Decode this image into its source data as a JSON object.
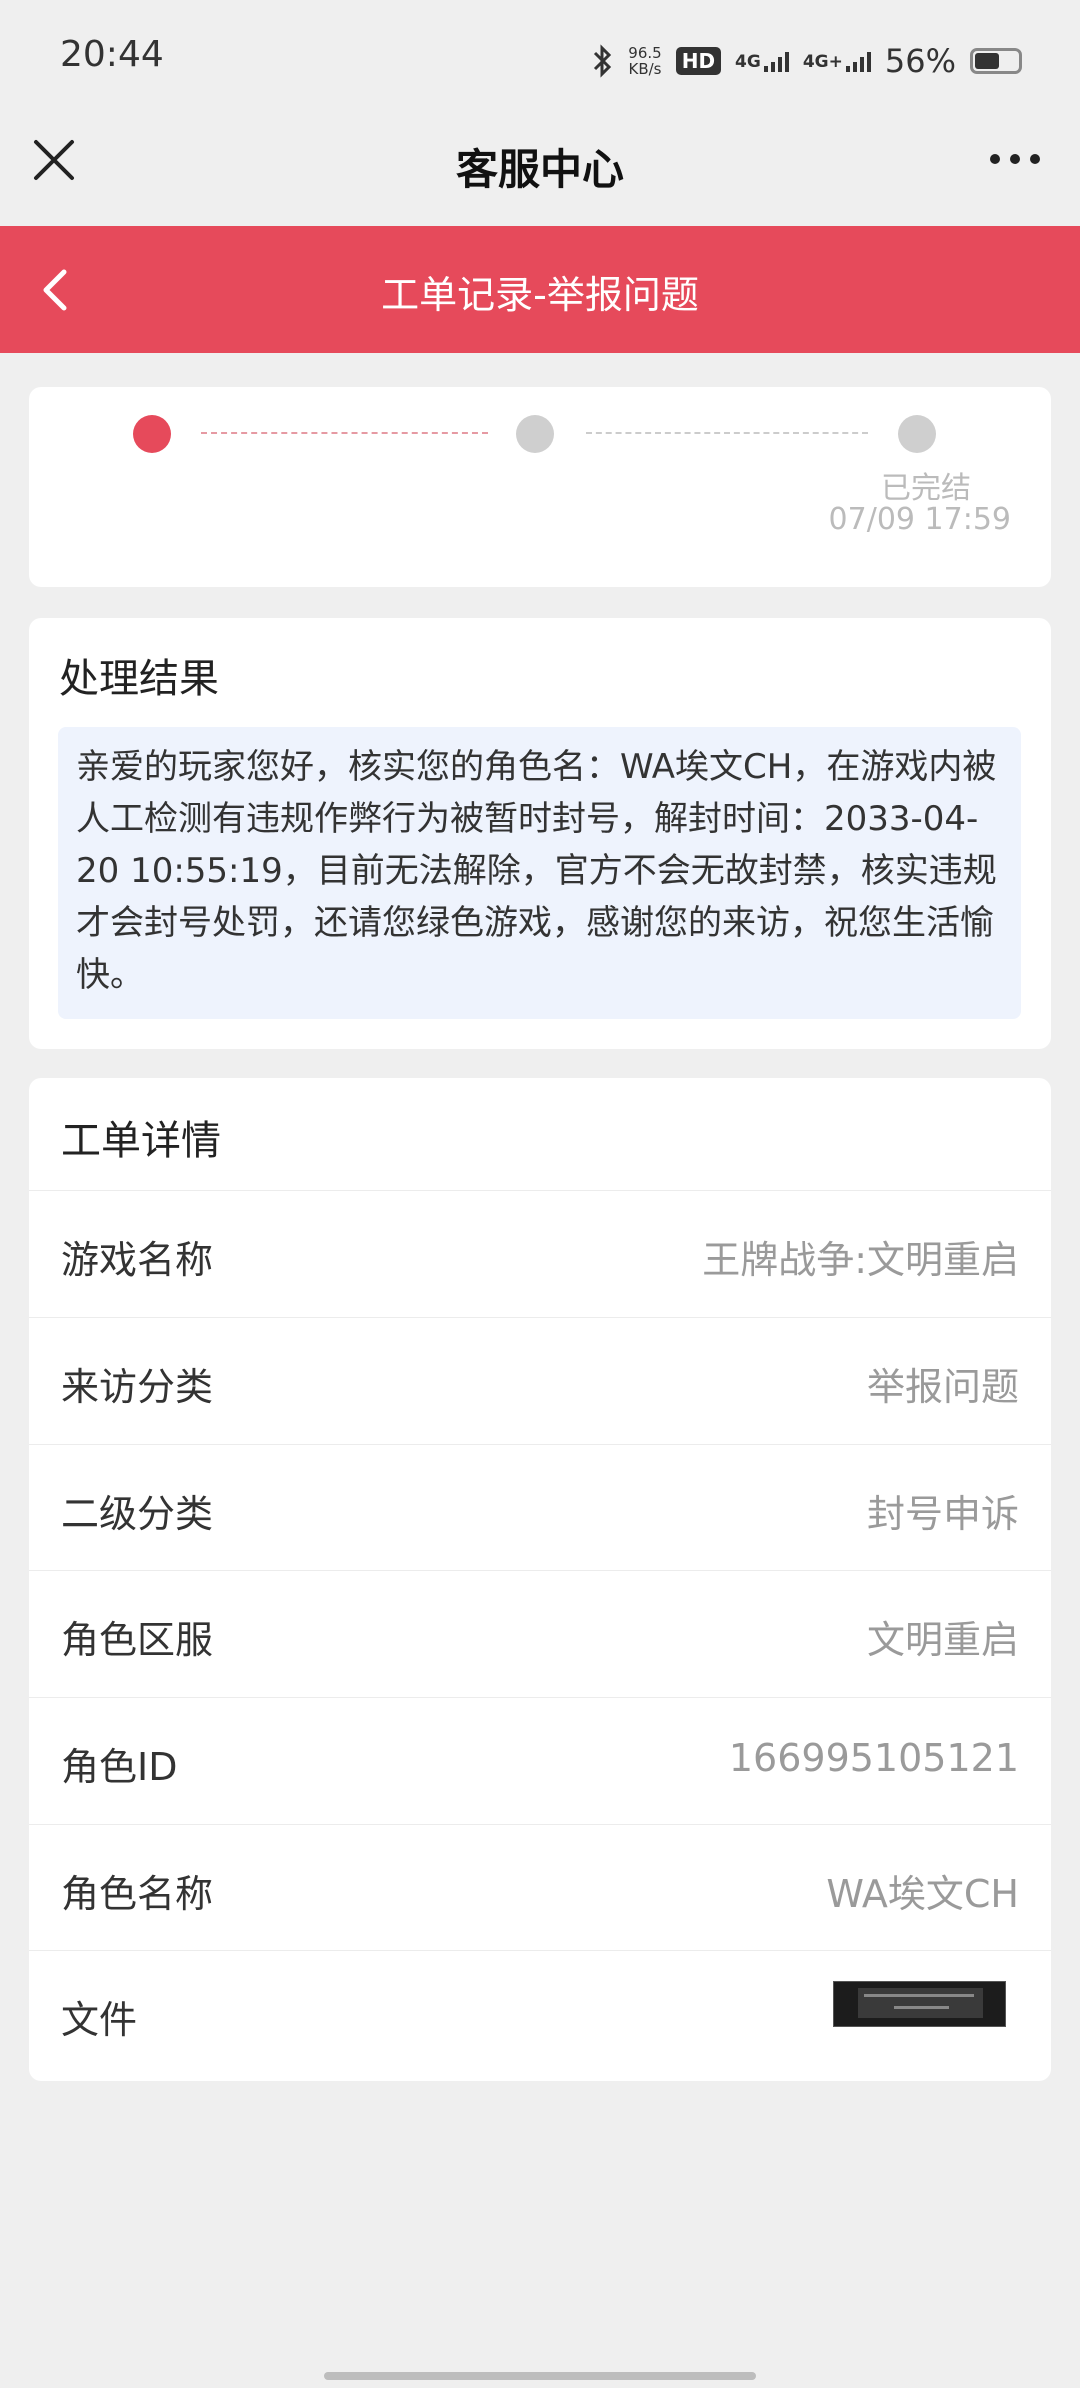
{
  "status_bar": {
    "time": "20:44",
    "speed_value": "96.5",
    "speed_unit": "KB/s",
    "hd_badge": "HD",
    "signal1_label": "4G",
    "signal2_label": "4G+",
    "battery_percent": "56%"
  },
  "nav": {
    "title": "客服中心"
  },
  "header": {
    "title": "工单记录-举报问题"
  },
  "progress": {
    "steps": [
      "",
      "",
      "已完结"
    ],
    "completed_time": "07/09 17:59",
    "colors": {
      "active": "#e64a5b",
      "inactive": "#cfcfcf"
    }
  },
  "result": {
    "title": "处理结果",
    "text": "亲爱的玩家您好，核实您的角色名：WA埃文CH，在游戏内被人工检测有违规作弊行为被暂时封号，解封时间：2033-04-20 10:55:19，目前无法解除，官方不会无故封禁，核实违规才会封号处罚，还请您绿色游戏，感谢您的来访，祝您生活愉快。"
  },
  "details": {
    "title": "工单详情",
    "rows": [
      {
        "label": "游戏名称",
        "value": "王牌战争:文明重启"
      },
      {
        "label": "来访分类",
        "value": "举报问题"
      },
      {
        "label": "二级分类",
        "value": "封号申诉"
      },
      {
        "label": "角色区服",
        "value": "文明重启"
      },
      {
        "label": "角色ID",
        "value": "166995105121"
      },
      {
        "label": "角色名称",
        "value": "WA埃文CH"
      },
      {
        "label": "文件",
        "value": ""
      }
    ]
  },
  "theme": {
    "accent": "#e64a5b",
    "page_bg": "#efefef",
    "result_bg": "#eef3fd"
  }
}
